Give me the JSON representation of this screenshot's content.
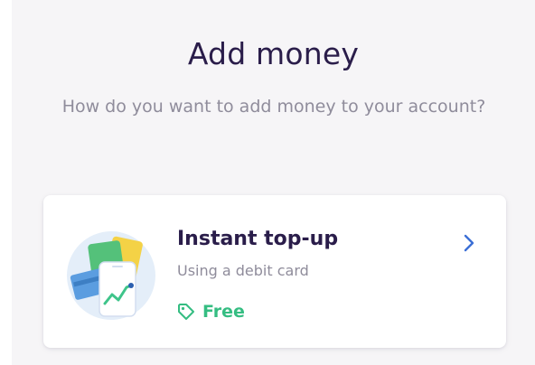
{
  "header": {
    "title": "Add money",
    "subtitle": "How do you want to add money to your account?"
  },
  "options": [
    {
      "title": "Instant top-up",
      "description": "Using a debit card",
      "price": "Free",
      "illustration": "debit-cards-phone-illustration",
      "price_icon": "tag-icon",
      "action_icon": "chevron-right-icon"
    }
  ],
  "colors": {
    "title": "#2a1d4a",
    "muted_text": "#8f8c9b",
    "price_green": "#35bd82",
    "chevron_blue": "#3b6fd6",
    "background": "#f6f5f7",
    "card": "#ffffff"
  }
}
